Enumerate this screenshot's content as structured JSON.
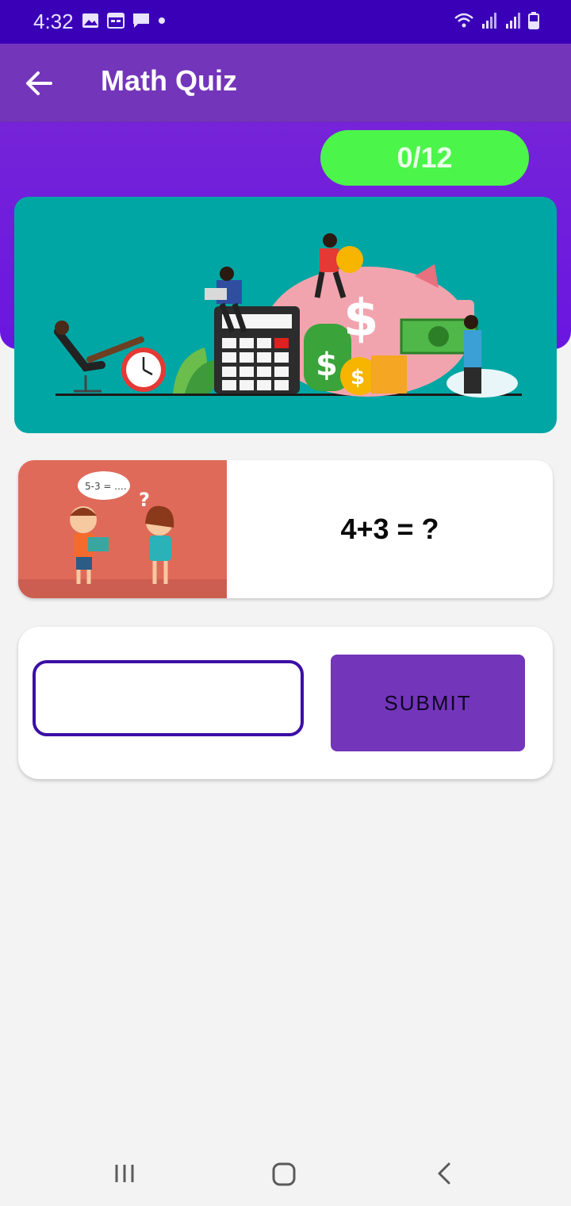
{
  "status_bar": {
    "time": "4:32",
    "left_icons": [
      "image-icon",
      "calendar-icon",
      "message-icon",
      "dot-icon"
    ],
    "right_icons": [
      "wifi-icon",
      "signal-icon",
      "signal-icon-2",
      "battery-icon"
    ]
  },
  "app_bar": {
    "title": "Math Quiz",
    "back_icon": "arrow-left-icon"
  },
  "score": "0/12",
  "question": {
    "image_bubble_text": "5-3 = ....",
    "text": "4+3 = ?"
  },
  "answer": {
    "value": "",
    "placeholder": "",
    "submit_label": "SUBMIT"
  },
  "nav_bar": {
    "icons": [
      "recent-apps-icon",
      "home-icon",
      "back-icon"
    ]
  },
  "colors": {
    "status_bar": "#3a00b8",
    "app_bar": "#7335ba",
    "score_pill": "#4cf54a",
    "banner": "#00a6a3",
    "input_border": "#3c0fa4"
  }
}
